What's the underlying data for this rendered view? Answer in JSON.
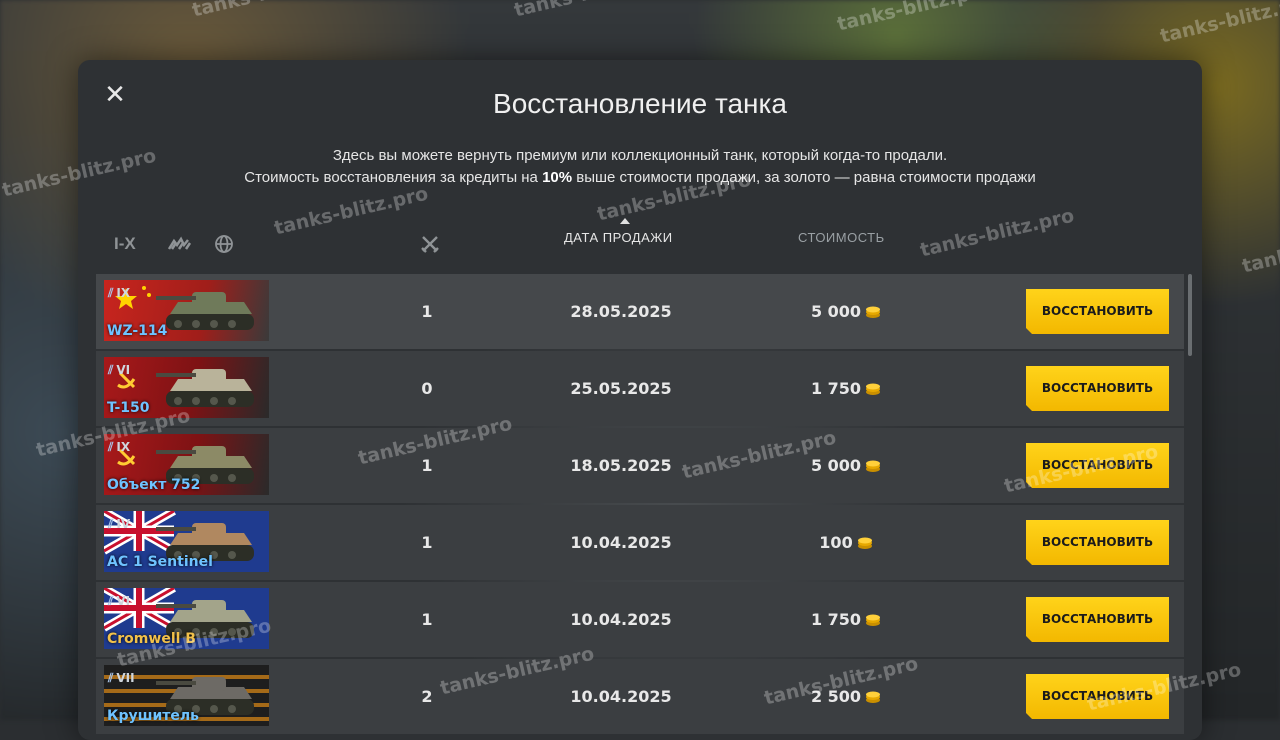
{
  "modal": {
    "title": "Восстановление танка",
    "desc_line1": "Здесь вы можете вернуть премиум или коллекционный танк, который когда-то продали.",
    "desc_line2_pre": "Стоимость восстановления за кредиты на ",
    "desc_line2_bold": "10%",
    "desc_line2_post": " выше стоимости продажи, за золото — равна стоимости продажи",
    "close_icon": "close-icon"
  },
  "filters": {
    "tier_label": "I-X",
    "type_icon": "tank-type-icon",
    "nation_icon": "globe-icon",
    "battles_icon": "crossed-swords-icon"
  },
  "columns": {
    "sale_date": "ДАТА ПРОДАЖИ",
    "cost": "СТОИМОСТЬ"
  },
  "rows": [
    {
      "tier": "IX",
      "name": "WZ-114",
      "nation": "china",
      "battles": "1",
      "date": "28.05.2025",
      "price": "5 000",
      "button": "ВОССТАНОВИТЬ",
      "name_color": "blue"
    },
    {
      "tier": "VI",
      "name": "T-150",
      "nation": "ussr",
      "battles": "0",
      "date": "25.05.2025",
      "price": "1 750",
      "button": "ВОССТАНОВИТЬ",
      "name_color": "blue"
    },
    {
      "tier": "IX",
      "name": "Объект 752",
      "nation": "ussr",
      "battles": "1",
      "date": "18.05.2025",
      "price": "5 000",
      "button": "ВОССТАНОВИТЬ",
      "name_color": "blue"
    },
    {
      "tier": "IV",
      "name": "AC 1 Sentinel",
      "nation": "uk",
      "battles": "1",
      "date": "10.04.2025",
      "price": "100",
      "button": "ВОССТАНОВИТЬ",
      "name_color": "blue"
    },
    {
      "tier": "VI",
      "name": "Cromwell B",
      "nation": "uk",
      "battles": "1",
      "date": "10.04.2025",
      "price": "1 750",
      "button": "ВОССТАНОВИТЬ",
      "name_color": "gold"
    },
    {
      "tier": "VII",
      "name": "Крушитель",
      "nation": "ussr-dark",
      "battles": "2",
      "date": "10.04.2025",
      "price": "2 500",
      "button": "ВОССТАНОВИТЬ",
      "name_color": "blue"
    }
  ],
  "watermark": "tanks-blitz.pro",
  "colors": {
    "accent": "#ffcc00",
    "tank_name_blue": "#6fc3ff",
    "tank_name_gold": "#f2c14a",
    "modal_bg": "#2e3134"
  }
}
